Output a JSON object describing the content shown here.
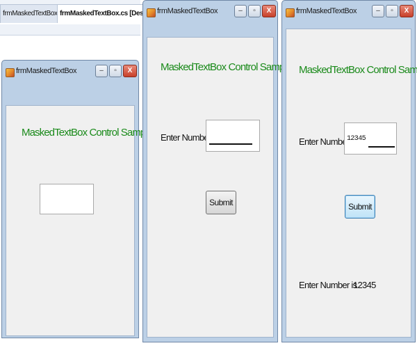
{
  "ide_tabs": [
    "frmMaskedTextBox.cs*",
    "frmMaskedTextBox.cs [Design]*"
  ],
  "window": {
    "title": "frmMaskedTextBox",
    "minimize_glyph": "–",
    "maximize_glyph": "▫",
    "close_glyph": "X"
  },
  "form": {
    "heading": "MaskedTextBox Control Sample",
    "number_label": "Enter Number",
    "submit_label": "Submit",
    "result_label": "Enter Number is",
    "result_value": "12345",
    "masked_value": "12345"
  },
  "colors": {
    "heading": "#1a8a1a",
    "titlebar": "#bcd0e6",
    "client": "#f0f0f0",
    "close_button": "#c8402a"
  }
}
